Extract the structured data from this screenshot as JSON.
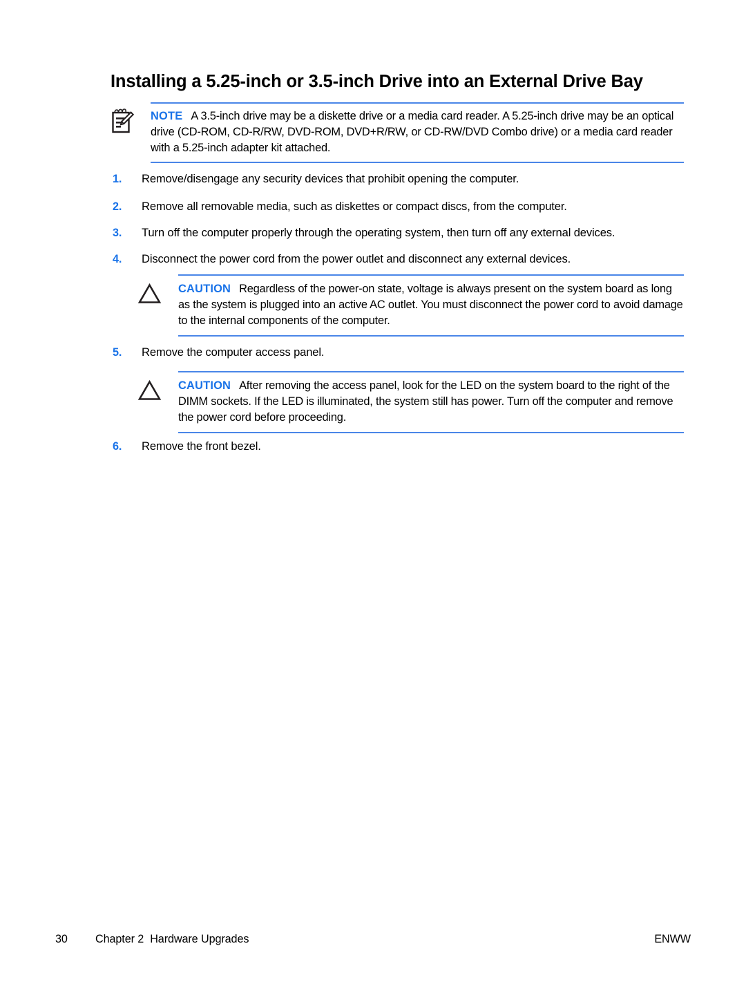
{
  "document": {
    "title": "Installing a 5.25-inch or 3.5-inch Drive into an External Drive Bay"
  },
  "note": {
    "icon": "notepad-pencil-icon",
    "label": "NOTE",
    "text": "A 3.5-inch drive may be a diskette drive or a media card reader. A 5.25-inch drive may be an optical drive (CD-ROM, CD-R/RW, DVD-ROM, DVD+R/RW, or CD-RW/DVD Combo drive) or a media card reader with a 5.25-inch adapter kit attached."
  },
  "cautions": [
    {
      "icon": "warning-triangle-icon",
      "label": "CAUTION",
      "text": "Regardless of the power-on state, voltage is always present on the system board as long as the system is plugged into an active AC outlet. You must disconnect the power cord to avoid damage to the internal components of the computer."
    },
    {
      "icon": "warning-triangle-icon",
      "label": "CAUTION",
      "text": "After removing the access panel, look for the LED on the system board to the right of the DIMM sockets. If the LED is illuminated, the system still has power. Turn off the computer and remove the power cord before proceeding."
    }
  ],
  "steps": [
    {
      "number": "1.",
      "text": "Remove/disengage any security devices that prohibit opening the computer."
    },
    {
      "number": "2.",
      "text": "Remove all removable media, such as diskettes or compact discs, from the computer."
    },
    {
      "number": "3.",
      "text": "Turn off the computer properly through the operating system, then turn off any external devices."
    },
    {
      "number": "4.",
      "text": "Disconnect the power cord from the power outlet and disconnect any external devices."
    },
    {
      "number": "5.",
      "text": "Remove the computer access panel."
    },
    {
      "number": "6.",
      "text": "Remove the front bezel."
    }
  ],
  "footer": {
    "page_number": "30",
    "chapter": "Chapter 2",
    "chapter_title": "Hardware Upgrades",
    "locale": "ENWW"
  },
  "colors": {
    "accent_blue": "#4a86e8",
    "label_blue": "#1a73e8",
    "text_black": "#000000",
    "page_background": "#ffffff"
  }
}
